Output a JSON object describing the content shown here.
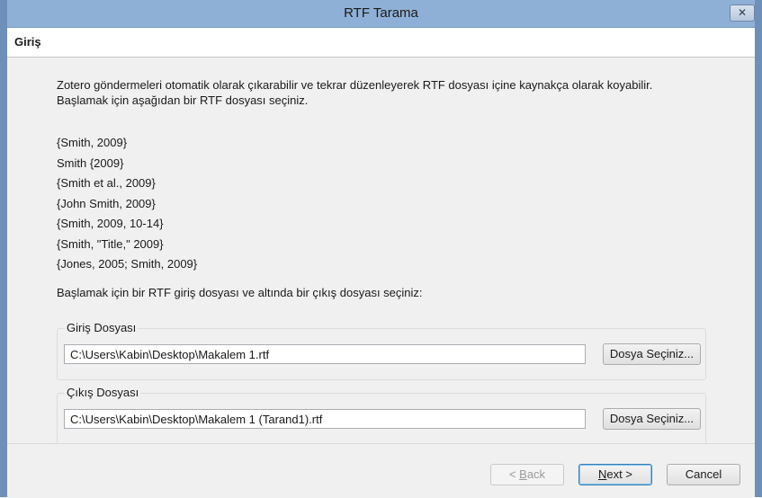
{
  "window": {
    "title": "RTF Tarama",
    "close_symbol": "✕"
  },
  "page": {
    "heading": "Giriş"
  },
  "intro": "Zotero göndermeleri otomatik olarak çıkarabilir ve tekrar düzenleyerek RTF dosyası içine kaynakça olarak koyabilir. Başlamak için aşağıdan bir RTF dosyası seçiniz.",
  "examples": [
    "{Smith, 2009}",
    "Smith {2009}",
    "{Smith et al., 2009}",
    "{John Smith, 2009}",
    "{Smith, 2009, 10-14}",
    "{Smith, \"Title,\" 2009}",
    "{Jones, 2005; Smith, 2009}"
  ],
  "prompt": "Başlamak için bir RTF giriş dosyası ve altında bir çıkış dosyası seçiniz:",
  "input_file": {
    "legend": "Giriş Dosyası",
    "value": "C:\\Users\\Kabin\\Desktop\\Makalem 1.rtf",
    "button": "Dosya Seçiniz..."
  },
  "output_file": {
    "legend": "Çıkış Dosyası",
    "value": "C:\\Users\\Kabin\\Desktop\\Makalem 1 (Tarand1).rtf",
    "button": "Dosya Seçiniz..."
  },
  "footer": {
    "back_accel": "B",
    "back_prefix": "< ",
    "back_rest": "ack",
    "next_accel": "N",
    "next_rest": "ext >",
    "cancel": "Cancel"
  },
  "colors": {
    "title_bar": "#8fb0d6",
    "frame": "#6e8fb8",
    "focus_border": "#3c7fb1"
  }
}
